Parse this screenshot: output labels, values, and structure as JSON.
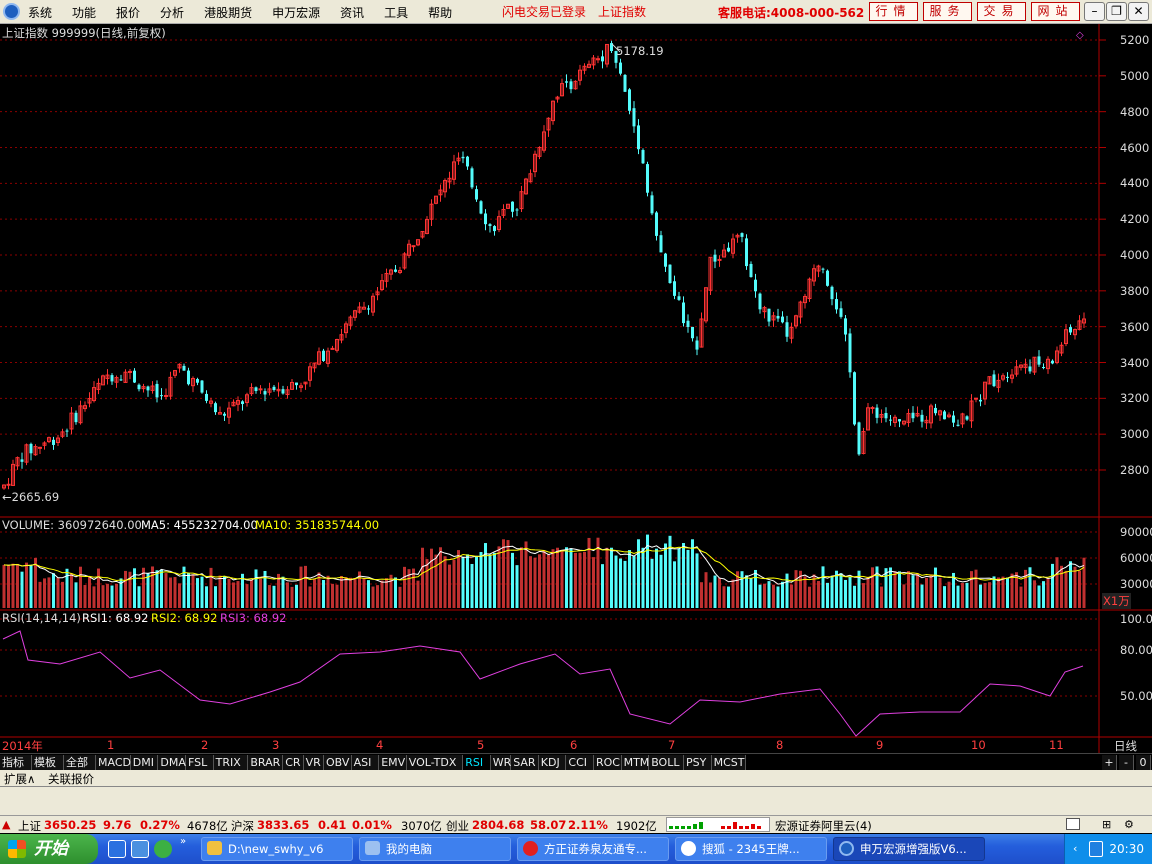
{
  "menubar": {
    "items": [
      "系统",
      "功能",
      "报价",
      "分析",
      "港股期货",
      "申万宏源",
      "资讯",
      "工具",
      "帮助"
    ],
    "flash_login": "闪电交易已登录",
    "index_name": "上证指数",
    "service_phone": "客服电话:4008-000-562",
    "trade_buttons": [
      "行情",
      "服务",
      "交易",
      "网站"
    ]
  },
  "chart": {
    "header": "上证指数 999999(日线,前复权)",
    "high_label": "5178.19",
    "low_label": "←2665.69",
    "volume_header": "VOLUME: 360972640.00",
    "ma5_label": "MA5: 455232704.00",
    "ma10_label": "MA10: 351835744.00",
    "rsi_title": "RSI(14,14,14)",
    "rsi1_label": "RSI1: 68.92",
    "rsi2_label": "RSI2: 68.92",
    "rsi3_label": "RSI3: 68.92",
    "volume_unit": "X1万",
    "period": "日线",
    "year_label": "2014年",
    "months": [
      "1",
      "2",
      "3",
      "4",
      "5",
      "6",
      "7",
      "8",
      "9",
      "10",
      "11"
    ],
    "price_ticks": [
      "5200",
      "5000",
      "4800",
      "4600",
      "4400",
      "4200",
      "4000",
      "3800",
      "3600",
      "3400",
      "3200",
      "3000",
      "2800"
    ],
    "volume_ticks": [
      "90000",
      "60000",
      "30000"
    ],
    "rsi_ticks": [
      "100.00",
      "80.00",
      "50.00"
    ]
  },
  "chart_data": {
    "type": "candlestick",
    "title": "上证指数 999999(日线,前复权)",
    "y_range": [
      2665.69,
      5178.19
    ],
    "annotated_high": 5178.19,
    "annotated_low": 2665.69,
    "close_points": [
      {
        "x": "2014年",
        "y": 2900
      },
      {
        "x": "1",
        "y": 3350
      },
      {
        "x": "2",
        "y": 3200
      },
      {
        "x": "3",
        "y": 3400
      },
      {
        "x": "4",
        "y": 4100
      },
      {
        "x": "5",
        "y": 4450
      },
      {
        "x": "6",
        "y": 5100
      },
      {
        "x": "7",
        "y": 3900
      },
      {
        "x": "8",
        "y": 3750
      },
      {
        "x": "9",
        "y": 3100
      },
      {
        "x": "10",
        "y": 3350
      },
      {
        "x": "11",
        "y": 3650
      }
    ],
    "volume": {
      "last": 360972640.0,
      "ma5": 455232704.0,
      "ma10": 351835744.0
    },
    "rsi": {
      "rsi1": 68.92,
      "rsi2": 68.92,
      "rsi3": 68.92,
      "ylim": [
        0,
        100
      ]
    }
  },
  "tabs": [
    "指标",
    "模板",
    "全部",
    "MACD",
    "DMI",
    "DMA",
    "FSL",
    "TRIX",
    "BRAR",
    "CR",
    "VR",
    "OBV",
    "ASI",
    "EMV",
    "VOL-TDX",
    "RSI",
    "WR",
    "SAR",
    "KDJ",
    "CCI",
    "ROC",
    "MTM",
    "BOLL",
    "PSY",
    "MCST"
  ],
  "active_tab": "RSI",
  "tab_controls": [
    "+",
    "-",
    "0"
  ],
  "subbar": [
    "扩展∧",
    "关联报价"
  ],
  "status": {
    "sh_label": "上证",
    "sh_value": "3650.25",
    "sh_change": "9.76",
    "sh_pct": "0.27%",
    "sh_amt": "4678亿",
    "hs_label": "沪深",
    "hs_value": "3833.65",
    "hs_change": "0.41",
    "hs_pct": "0.01%",
    "hs_amt": "3070亿",
    "cy_label": "创业",
    "cy_value": "2804.68",
    "cy_change": "58.07",
    "cy_pct": "2.11%",
    "cy_amt": "1902亿",
    "server": "宏源证券阿里云(4)"
  },
  "taskbar": {
    "start": "开始",
    "tasks": [
      "D:\\new_swhy_v6",
      "我的电脑",
      "方正证券泉友通专...",
      "搜狐 - 2345王牌...",
      "申万宏源增强版V6..."
    ],
    "clock": "20:30"
  },
  "colors": {
    "up": "#FF3333",
    "down": "#54FCFC",
    "rsi": "#E040E0",
    "ma5": "#FFFFFF",
    "ma10": "#FFFF00",
    "grid": "#8B0000"
  }
}
